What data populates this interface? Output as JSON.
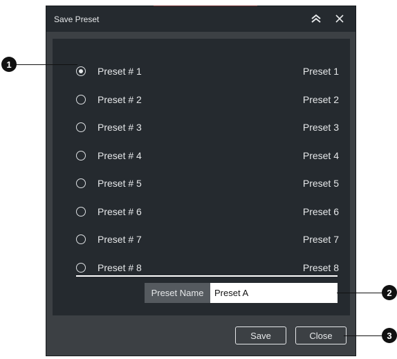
{
  "dialog": {
    "title": "Save Preset",
    "collapse_icon": "chevron-up-icon",
    "close_icon": "close-icon"
  },
  "presets": [
    {
      "label": "Preset # 1",
      "value": "Preset 1",
      "selected": true
    },
    {
      "label": "Preset # 2",
      "value": "Preset 2",
      "selected": false
    },
    {
      "label": "Preset # 3",
      "value": "Preset 3",
      "selected": false
    },
    {
      "label": "Preset # 4",
      "value": "Preset 4",
      "selected": false
    },
    {
      "label": "Preset # 5",
      "value": "Preset 5",
      "selected": false
    },
    {
      "label": "Preset # 6",
      "value": "Preset 6",
      "selected": false
    },
    {
      "label": "Preset # 7",
      "value": "Preset 7",
      "selected": false
    },
    {
      "label": "Preset # 8",
      "value": "Preset 8",
      "selected": false
    }
  ],
  "preset_name": {
    "label": "Preset Name",
    "value": "Preset A"
  },
  "buttons": {
    "save": "Save",
    "close": "Close"
  },
  "callouts": [
    "1",
    "2",
    "3"
  ],
  "colors": {
    "dialog_bg": "#3c4044",
    "panel_bg": "#252a2f",
    "text": "#e6e8ea",
    "callout": "#111111"
  }
}
